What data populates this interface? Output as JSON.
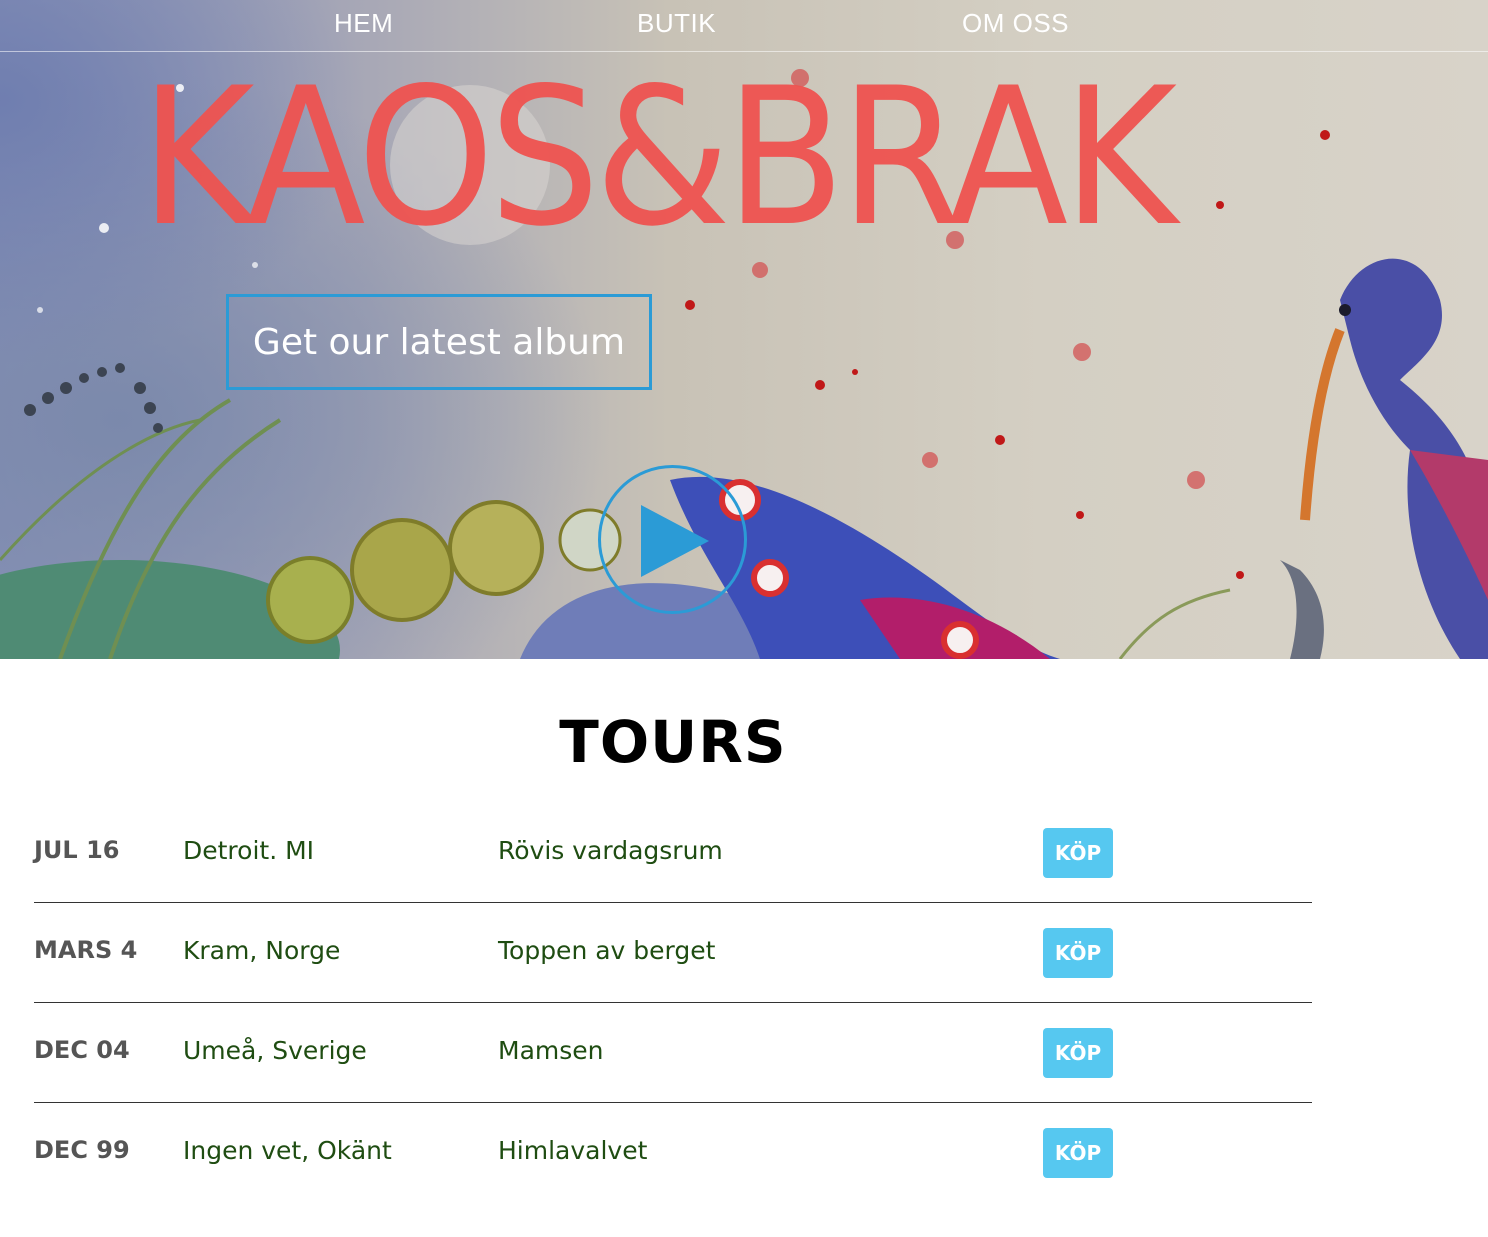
{
  "nav": {
    "items": [
      {
        "label": "HEM"
      },
      {
        "label": "BUTIK"
      },
      {
        "label": "OM OSS"
      }
    ]
  },
  "hero": {
    "brand": "KAOS&BRAK",
    "album_button": "Get our latest album",
    "play_icon": "play-icon",
    "colors": {
      "brand": "#ef5350",
      "accent": "#2b9bd6"
    }
  },
  "tours": {
    "title": "TOURS",
    "buy_label": "KÖP",
    "buy_color": "#56c8f0",
    "rows": [
      {
        "date": "JUL 16",
        "city": "Detroit. MI",
        "venue": "Rövis vardagsrum"
      },
      {
        "date": "MARS 4",
        "city": "Kram, Norge",
        "venue": "Toppen av berget"
      },
      {
        "date": "DEC 04",
        "city": "Umeå, Sverige",
        "venue": "Mamsen"
      },
      {
        "date": "DEC 99",
        "city": "Ingen vet, Okänt",
        "venue": "Himlavalvet"
      }
    ]
  }
}
